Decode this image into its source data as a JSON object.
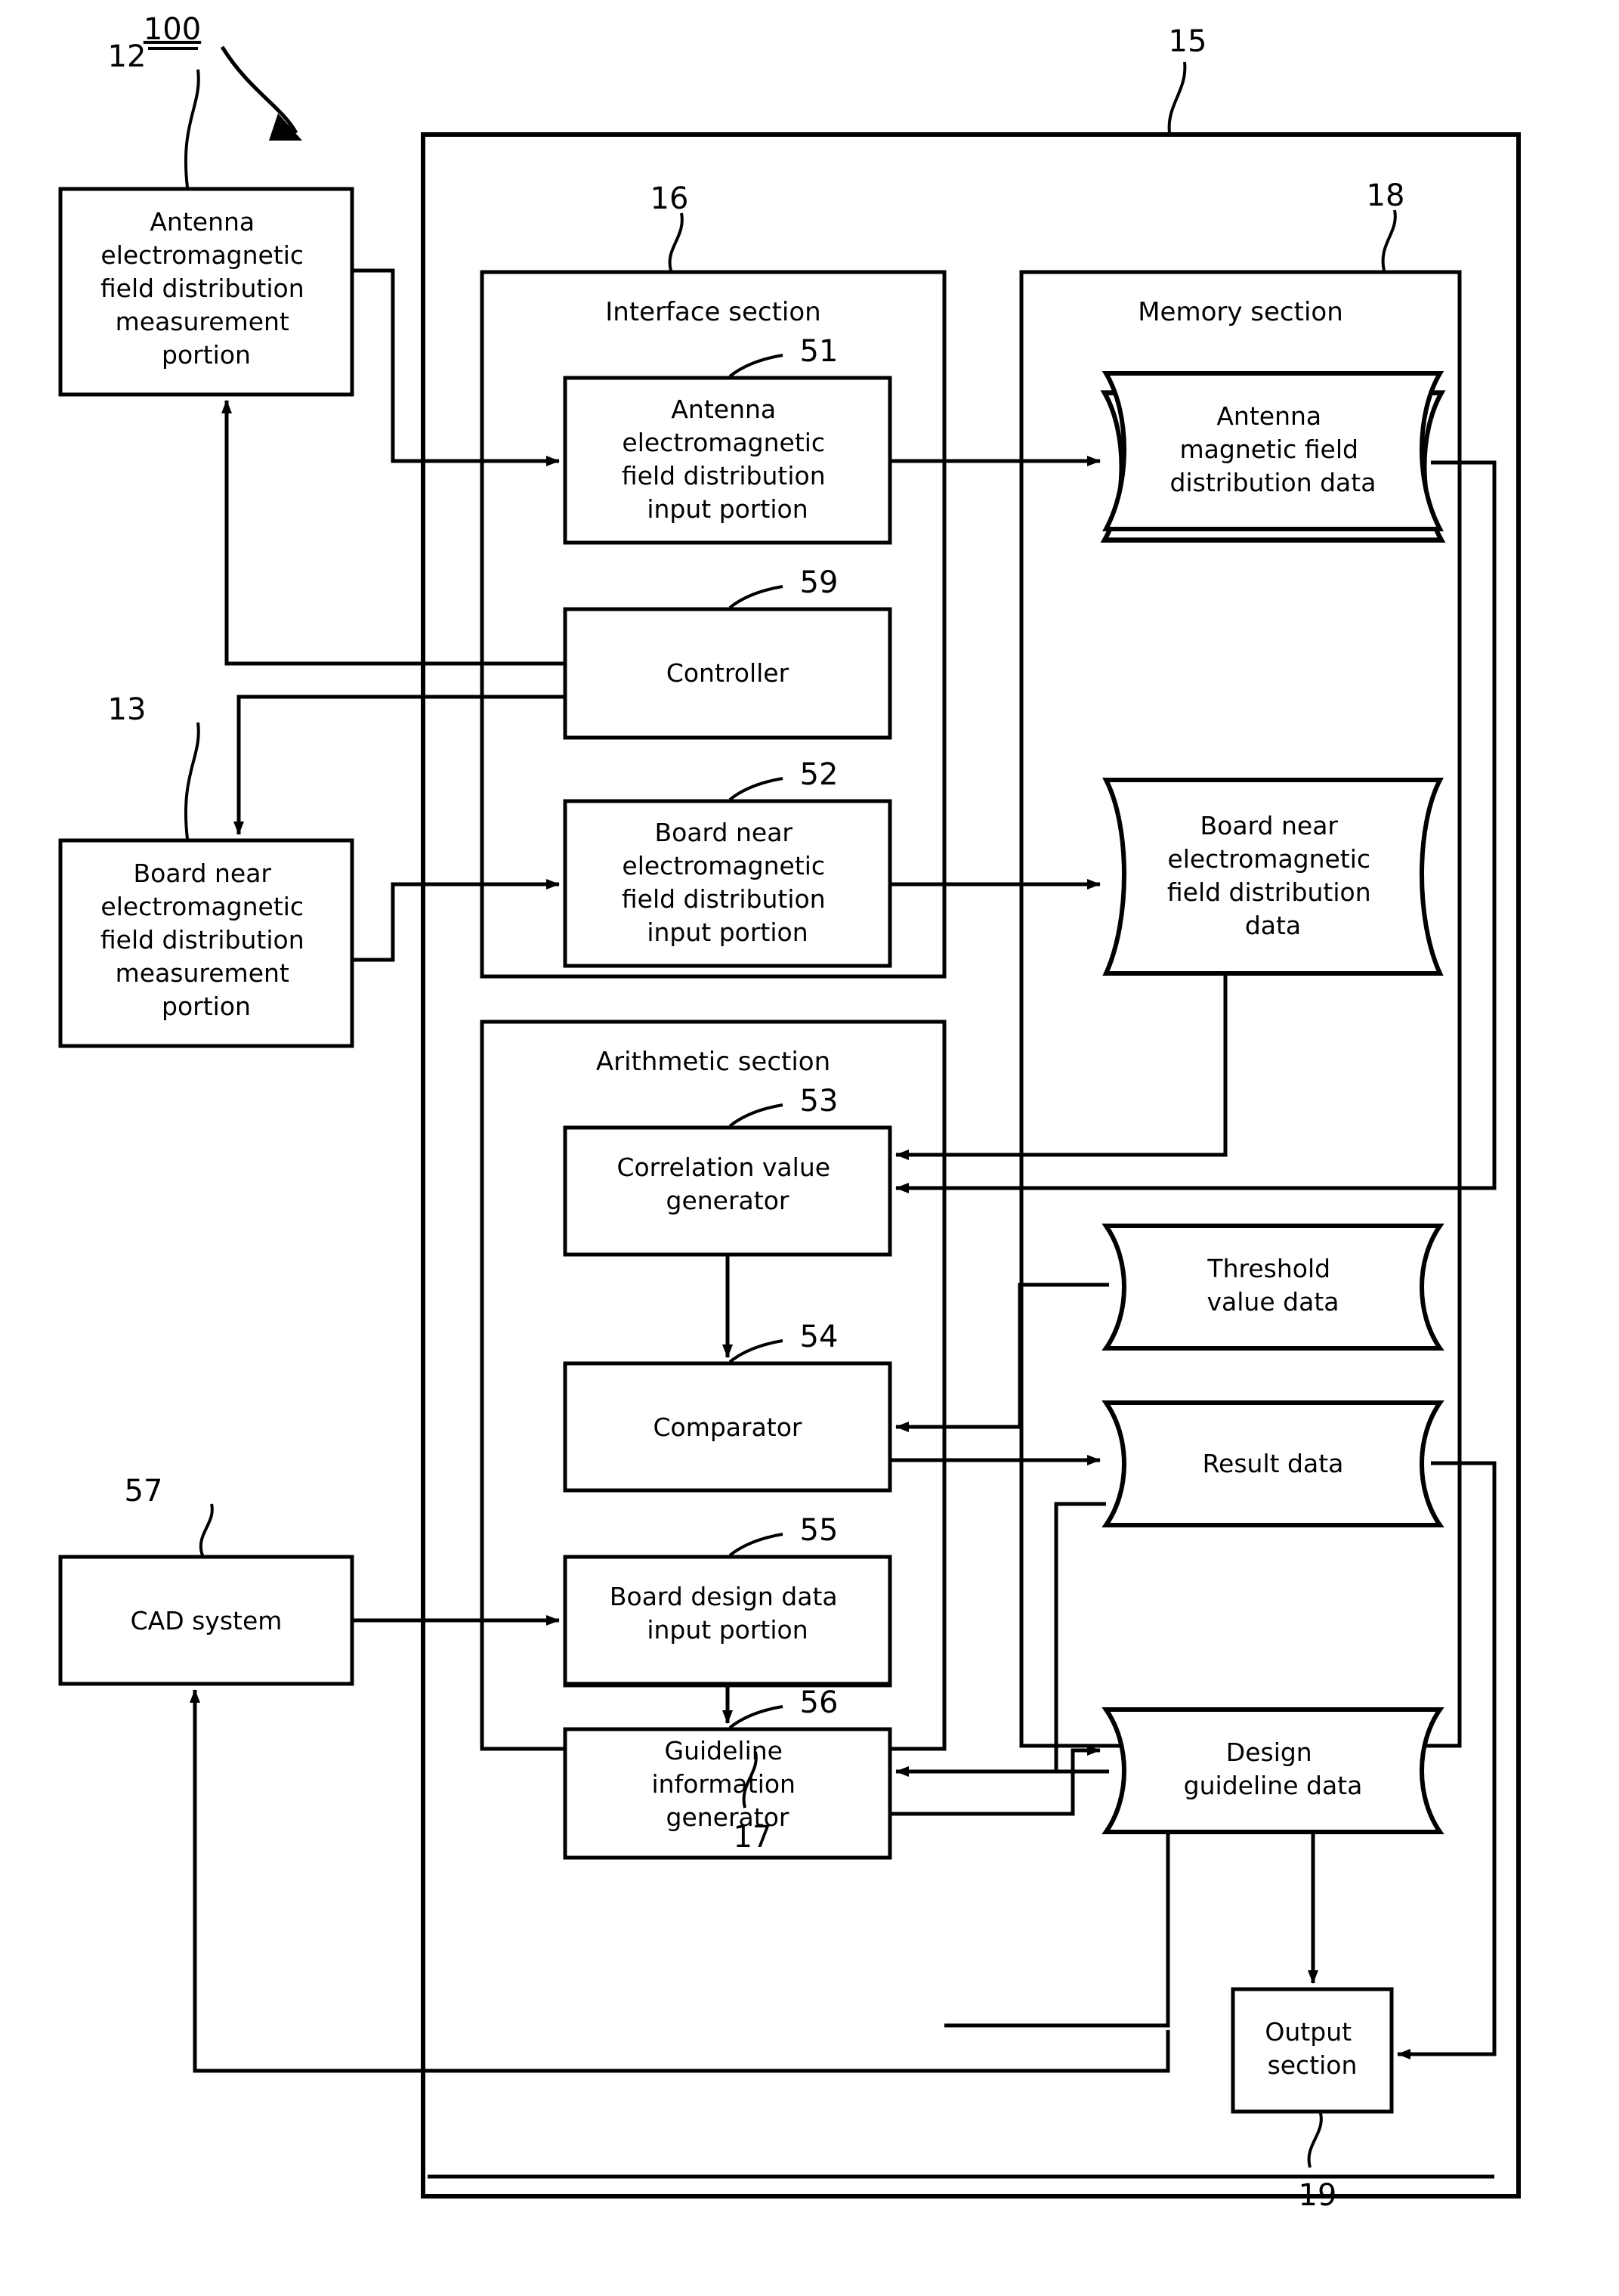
{
  "figure": {
    "system_reference": "100",
    "outer_reference": "15"
  },
  "external_blocks": [
    {
      "id": "antenna-measurement",
      "ref": "12",
      "lines": [
        "Antenna",
        "electromagnetic",
        "field distribution",
        "measurement",
        "portion"
      ]
    },
    {
      "id": "board-measurement",
      "ref": "13",
      "lines": [
        "Board near",
        "electromagnetic",
        "field distribution",
        "measurement",
        "portion"
      ]
    },
    {
      "id": "cad-system",
      "ref": "57",
      "lines": [
        "CAD system"
      ]
    }
  ],
  "sections": [
    {
      "id": "interface-section",
      "ref": "16",
      "title": "Interface section",
      "blocks": [
        {
          "id": "antenna-input-portion",
          "ref": "51",
          "lines": [
            "Antenna",
            "electromagnetic",
            "field distribution",
            "input portion"
          ]
        },
        {
          "id": "controller",
          "ref": "59",
          "lines": [
            "Controller"
          ]
        },
        {
          "id": "board-input-portion",
          "ref": "52",
          "lines": [
            "Board near",
            "electromagnetic",
            "field distribution",
            "input portion"
          ]
        }
      ]
    },
    {
      "id": "memory-section",
      "ref": "18",
      "title": "Memory section",
      "blocks": [
        {
          "id": "antenna-magnetic-field-data",
          "lines": [
            "Antenna",
            "magnetic field",
            "distribution data"
          ]
        },
        {
          "id": "board-near-field-data",
          "lines": [
            "Board near",
            "electromagnetic",
            "field distribution",
            "data"
          ]
        },
        {
          "id": "threshold-value-data",
          "lines": [
            "Threshold",
            "value data"
          ]
        },
        {
          "id": "result-data",
          "lines": [
            "Result data"
          ]
        },
        {
          "id": "design-guideline-data",
          "lines": [
            "Design",
            "guideline data"
          ]
        }
      ]
    },
    {
      "id": "arithmetic-section",
      "ref": "17",
      "title": "Arithmetic section",
      "blocks": [
        {
          "id": "correlation-value-generator",
          "ref": "53",
          "lines": [
            "Correlation value",
            "generator"
          ]
        },
        {
          "id": "comparator",
          "ref": "54",
          "lines": [
            "Comparator"
          ]
        },
        {
          "id": "board-design-data-input-portion",
          "ref": "55",
          "lines": [
            "Board design data",
            "input portion"
          ]
        },
        {
          "id": "guideline-information-generator",
          "ref": "56",
          "lines": [
            "Guideline",
            "information",
            "generator"
          ]
        }
      ]
    }
  ],
  "output_block": {
    "id": "output-section",
    "ref": "19",
    "lines": [
      "Output",
      "section"
    ]
  },
  "colors": {
    "line": "#000000",
    "background": "#ffffff"
  }
}
